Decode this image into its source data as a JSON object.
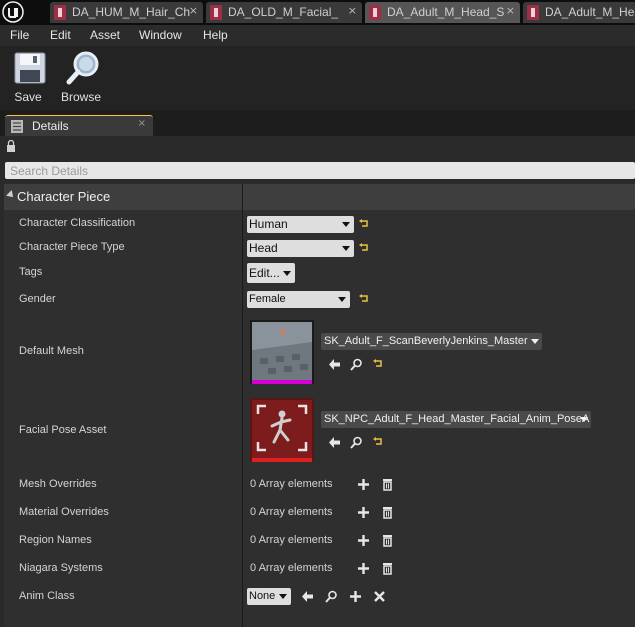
{
  "tabs": [
    {
      "label": "DA_HUM_M_Hair_Ch",
      "close": "×",
      "active": false
    },
    {
      "label": "DA_OLD_M_Facial_",
      "close": "×",
      "active": false
    },
    {
      "label": "DA_Adult_M_Head_S",
      "close": "×",
      "active": true
    },
    {
      "label": "DA_Adult_M_Head"
    }
  ],
  "menu": [
    "File",
    "Edit",
    "Asset",
    "Window",
    "Help"
  ],
  "toolbar": {
    "save_label": "Save",
    "browse_label": "Browse"
  },
  "details_tab": {
    "label": "Details",
    "close": "×"
  },
  "search": {
    "placeholder": "Search Details"
  },
  "category": {
    "title": "Character Piece"
  },
  "properties": {
    "character_classification": {
      "label": "Character Classification",
      "value": "Human"
    },
    "character_piece_type": {
      "label": "Character Piece Type",
      "value": "Head"
    },
    "tags": {
      "label": "Tags",
      "value": "Edit..."
    },
    "gender": {
      "label": "Gender",
      "value": "Female"
    },
    "default_mesh": {
      "label": "Default Mesh",
      "value": "SK_Adult_F_ScanBeverlyJenkins_Master"
    },
    "facial_pose_asset": {
      "label": "Facial Pose Asset",
      "value": "SK_NPC_Adult_F_Head_Master_Facial_Anim_PoseA"
    },
    "mesh_overrides": {
      "label": "Mesh Overrides",
      "value": "0 Array elements"
    },
    "material_overrides": {
      "label": "Material Overrides",
      "value": "0 Array elements"
    },
    "region_names": {
      "label": "Region Names",
      "value": "0 Array elements"
    },
    "niagara_systems": {
      "label": "Niagara Systems",
      "value": "0 Array elements"
    },
    "anim_class": {
      "label": "Anim Class",
      "value": "None"
    }
  },
  "colors": {
    "accent": "#f0c94a",
    "asset_tab_icon": "#9c2f45",
    "mesh_bar": "#d600d6",
    "anim_bar": "#e02020",
    "reset_arrow": "#e8c240"
  },
  "icons": [
    "unreal-logo-icon",
    "save-icon",
    "browse-icon",
    "lock-icon",
    "reset-arrow-icon",
    "use-selected-icon",
    "browse-asset-icon",
    "add-icon",
    "delete-icon",
    "clear-icon"
  ]
}
